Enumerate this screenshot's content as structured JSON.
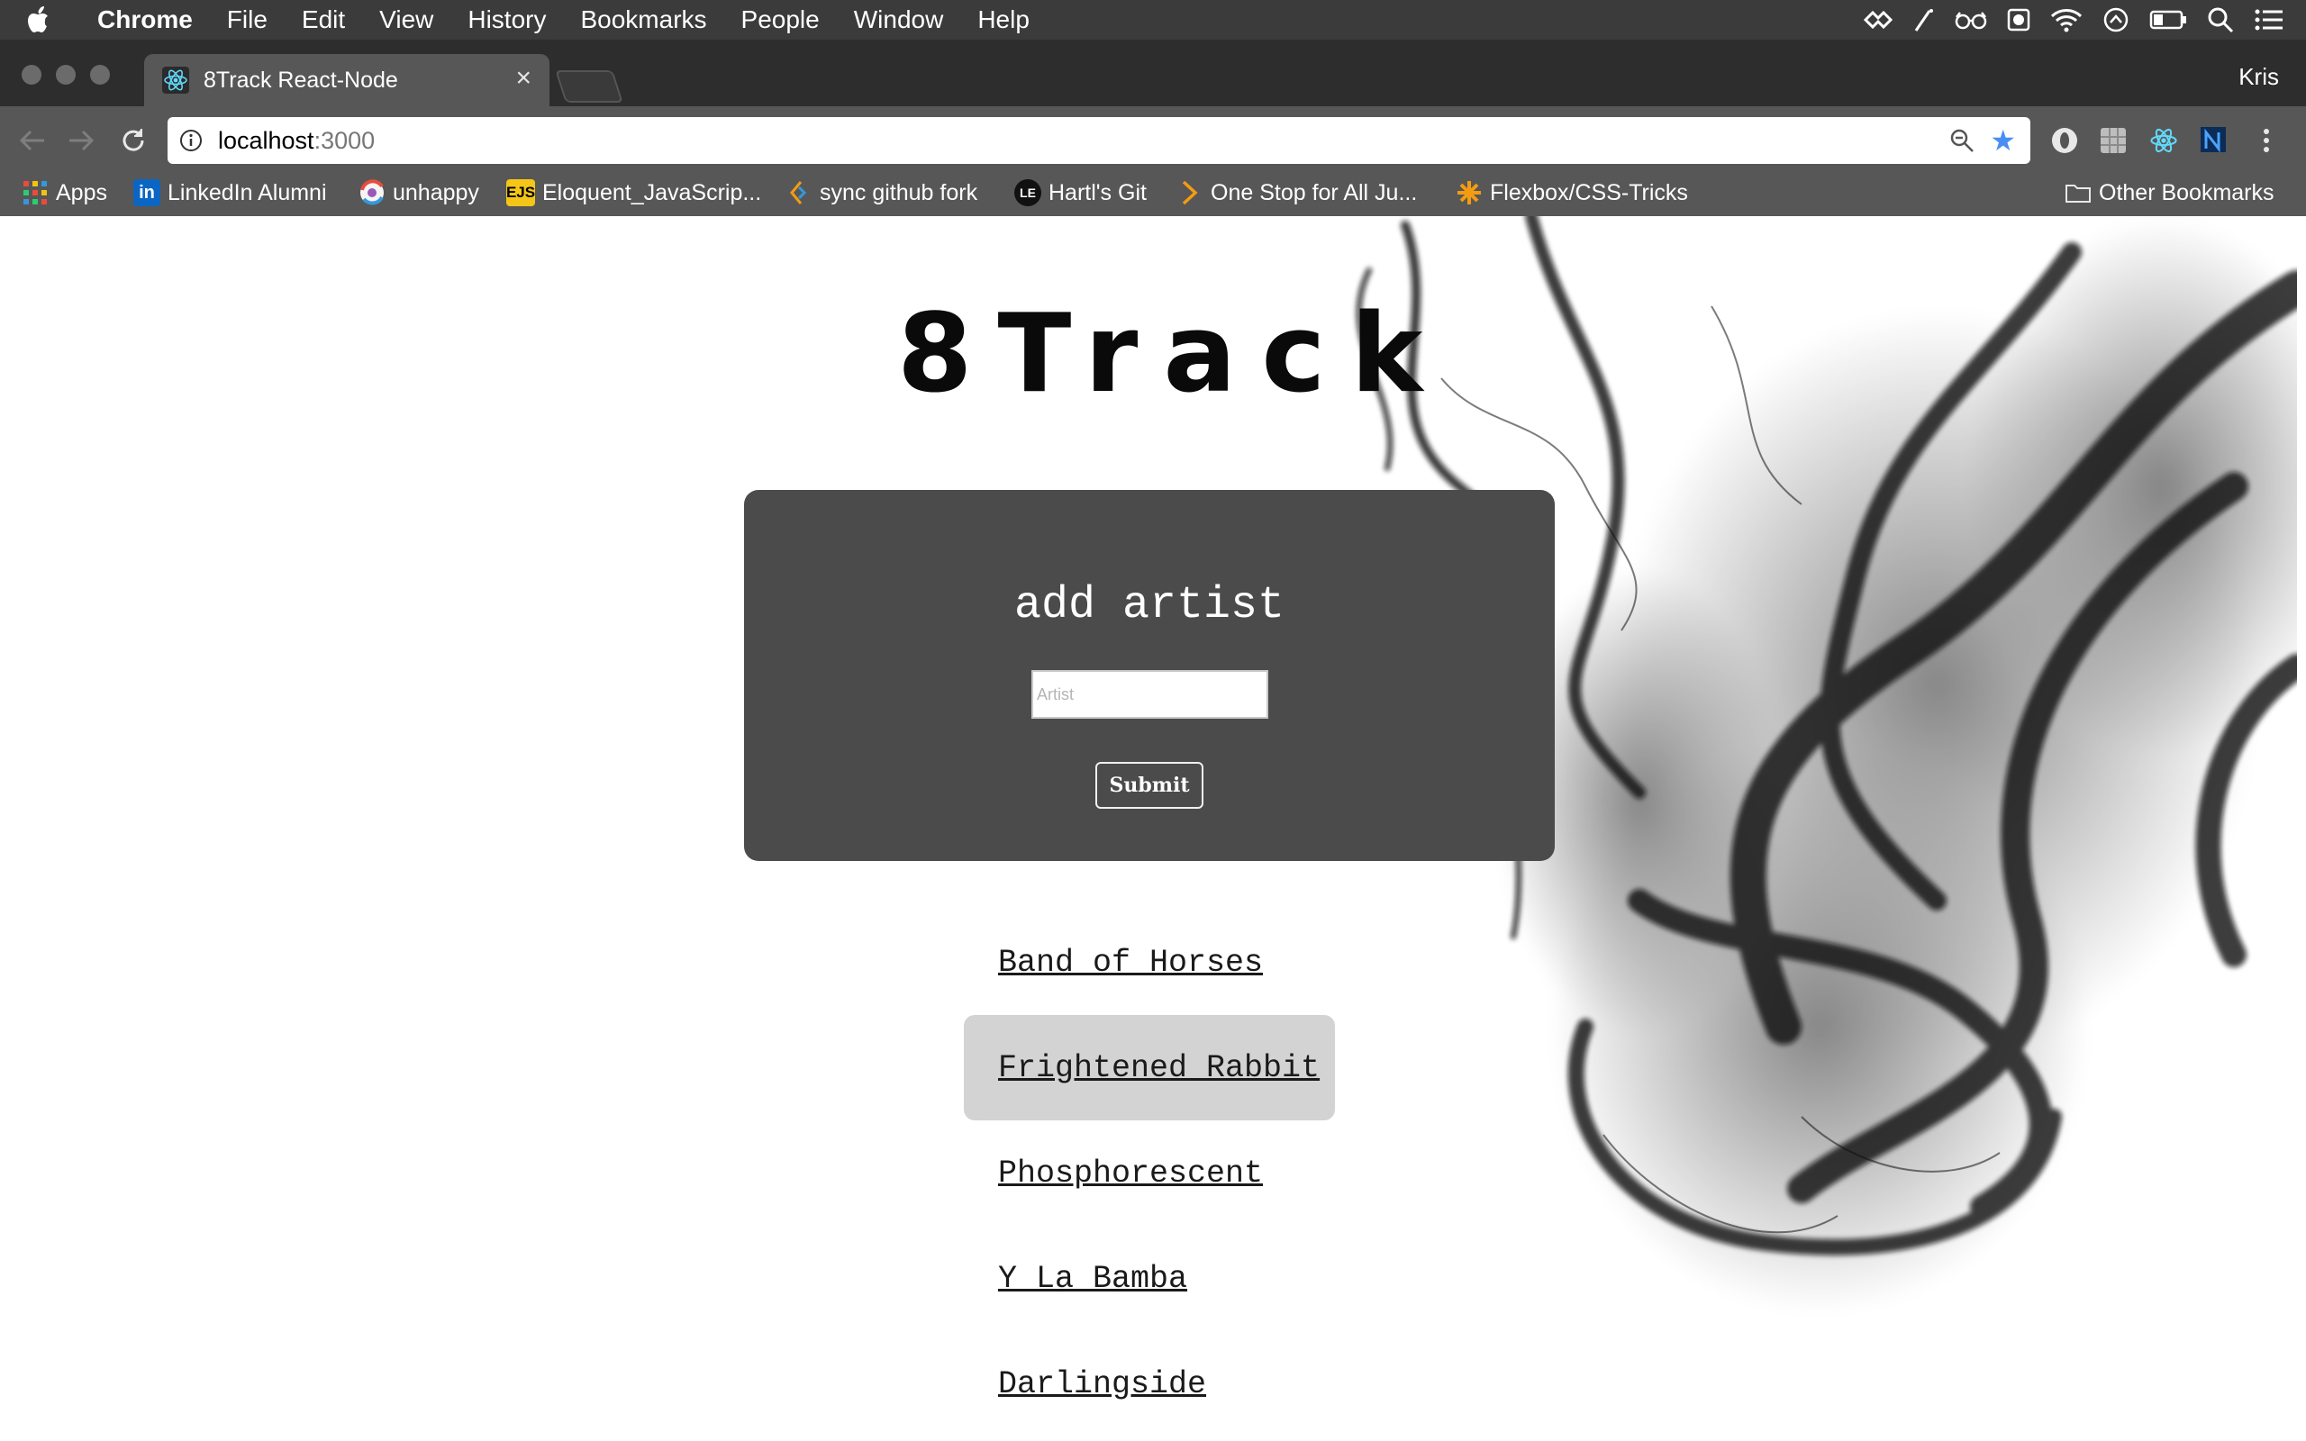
{
  "menubar": {
    "app_name": "Chrome",
    "items": [
      "File",
      "Edit",
      "View",
      "History",
      "Bookmarks",
      "People",
      "Window",
      "Help"
    ],
    "status_icons": [
      "dropbox-icon",
      "wand-icon",
      "glasses-icon",
      "record-icon",
      "wifi-icon",
      "sync-icon",
      "battery-icon",
      "spotlight-icon",
      "notification-center-icon"
    ]
  },
  "window": {
    "tab_title": "8Track React-Node",
    "close_glyph": "×",
    "profile_name": "Kris"
  },
  "toolbar": {
    "url_host": "localhost",
    "url_port": ":3000"
  },
  "bookmarks": {
    "items": [
      {
        "label": "Apps",
        "icon": "apps-grid-icon"
      },
      {
        "label": "LinkedIn Alumni",
        "icon": "linkedin-icon",
        "icon_text": "in"
      },
      {
        "label": "unhappy",
        "icon": "unhappy-icon"
      },
      {
        "label": "Eloquent_JavaScrip...",
        "icon": "ejs-icon",
        "icon_text": "EJS"
      },
      {
        "label": "sync github fork",
        "icon": "code-icon"
      },
      {
        "label": "Hartl's Git",
        "icon": "hartl-icon",
        "icon_text": "LE"
      },
      {
        "label": "One Stop for All Ju...",
        "icon": "chevron-right-icon"
      },
      {
        "label": "Flexbox/CSS-Tricks",
        "icon": "asterisk-icon"
      }
    ],
    "other": "Other Bookmarks"
  },
  "page": {
    "logo": "8Track",
    "form": {
      "heading": "add artist",
      "input_placeholder": "Artist",
      "input_value": "",
      "submit_label": "Submit"
    },
    "artists": [
      {
        "name": "Band of Horses",
        "hovered": false
      },
      {
        "name": "Frightened Rabbit",
        "hovered": true
      },
      {
        "name": "Phosphorescent",
        "hovered": false
      },
      {
        "name": "Y La Bamba",
        "hovered": false
      },
      {
        "name": "Darlingside",
        "hovered": false
      }
    ]
  },
  "colors": {
    "menubar_bg": "#3b3b3b",
    "tabstrip_bg": "#2d2d2d",
    "toolbar_bg": "#575757",
    "panel_bg": "#4b4b4b",
    "hover_bg": "#d3d3d3",
    "star_blue": "#4a8ef5"
  }
}
